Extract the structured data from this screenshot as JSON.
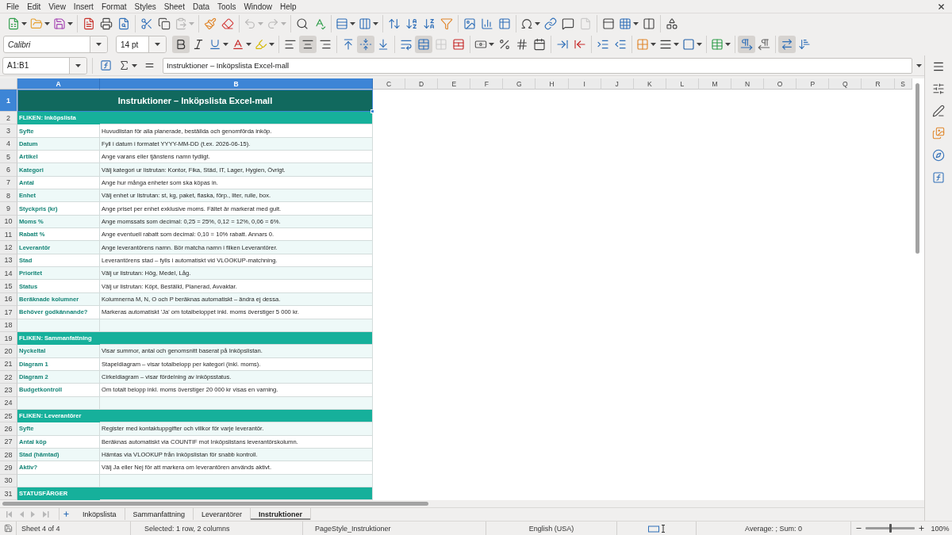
{
  "menu_bar": {
    "items": [
      "File",
      "Edit",
      "View",
      "Insert",
      "Format",
      "Styles",
      "Sheet",
      "Data",
      "Tools",
      "Window",
      "Help"
    ]
  },
  "standard_toolbar": {
    "groups": [
      {
        "items": [
          {
            "kind": "new",
            "dropdown": true,
            "disabled": false
          },
          {
            "kind": "open",
            "dropdown": true,
            "disabled": false
          },
          {
            "kind": "save",
            "dropdown": true,
            "disabled": false
          }
        ]
      },
      {
        "items": [
          {
            "kind": "export_pdf",
            "disabled": false
          },
          {
            "kind": "print",
            "disabled": false
          },
          {
            "kind": "print_preview",
            "disabled": false
          }
        ]
      },
      {
        "items": [
          {
            "kind": "cut",
            "disabled": false
          },
          {
            "kind": "copy",
            "disabled": false
          },
          {
            "kind": "paste",
            "dropdown": true,
            "disabled": true
          }
        ]
      },
      {
        "items": [
          {
            "kind": "clone_formatting",
            "disabled": false
          },
          {
            "kind": "clear_formatting",
            "disabled": false
          }
        ]
      },
      {
        "items": [
          {
            "kind": "undo",
            "dropdown": true,
            "disabled": true
          },
          {
            "kind": "redo",
            "dropdown": true,
            "disabled": true
          }
        ]
      },
      {
        "items": [
          {
            "kind": "find_replace",
            "disabled": false
          },
          {
            "kind": "spelling",
            "disabled": false
          }
        ]
      },
      {
        "items": [
          {
            "kind": "rows",
            "dropdown": true,
            "disabled": false
          },
          {
            "kind": "columns",
            "dropdown": true,
            "disabled": false
          }
        ]
      },
      {
        "items": [
          {
            "kind": "sort",
            "disabled": false
          },
          {
            "kind": "sort_ascending",
            "disabled": false
          },
          {
            "kind": "sort_descending",
            "disabled": false
          },
          {
            "kind": "autofilter",
            "disabled": false
          }
        ]
      },
      {
        "items": [
          {
            "kind": "image",
            "disabled": false
          },
          {
            "kind": "chart",
            "disabled": false
          },
          {
            "kind": "pivot_table",
            "disabled": false
          }
        ]
      },
      {
        "items": [
          {
            "kind": "special_character",
            "dropdown": true,
            "disabled": false
          },
          {
            "kind": "hyperlink",
            "disabled": false
          },
          {
            "kind": "comment",
            "disabled": false
          },
          {
            "kind": "headers_footers",
            "disabled": true
          }
        ]
      },
      {
        "items": [
          {
            "kind": "print_area",
            "disabled": false
          },
          {
            "kind": "freeze",
            "dropdown": true,
            "disabled": false
          },
          {
            "kind": "split_window",
            "disabled": false
          }
        ]
      },
      {
        "items": [
          {
            "kind": "draw_functions",
            "disabled": false
          }
        ]
      }
    ]
  },
  "formatting_toolbar": {
    "font_name": "Calibri",
    "font_size": "14 pt",
    "groups": [
      {
        "items": [
          {
            "kind": "bold",
            "pressed": true,
            "disabled": false
          },
          {
            "kind": "italic",
            "pressed": false,
            "disabled": false
          },
          {
            "kind": "underline",
            "dropdown": true,
            "pressed": false,
            "disabled": false
          },
          {
            "kind": "font_color",
            "dropdown": true,
            "pressed": false,
            "disabled": false
          },
          {
            "kind": "highlight",
            "dropdown": true,
            "pressed": false,
            "disabled": false
          }
        ]
      },
      {
        "items": [
          {
            "kind": "align_left",
            "pressed": false,
            "disabled": false
          },
          {
            "kind": "align_center",
            "pressed": true,
            "disabled": false
          },
          {
            "kind": "align_right",
            "pressed": false,
            "disabled": false
          }
        ]
      },
      {
        "items": [
          {
            "kind": "align_top",
            "pressed": false,
            "disabled": false
          },
          {
            "kind": "align_middle",
            "pressed": true,
            "disabled": false
          },
          {
            "kind": "align_bottom",
            "pressed": false,
            "disabled": false
          }
        ]
      },
      {
        "items": [
          {
            "kind": "wrap_text",
            "pressed": false,
            "disabled": false
          },
          {
            "kind": "merge_center",
            "pressed": true,
            "disabled": false
          },
          {
            "kind": "merge_cells",
            "pressed": false,
            "disabled": true
          },
          {
            "kind": "unmerge",
            "pressed": false,
            "disabled": false
          }
        ]
      },
      {
        "items": [
          {
            "kind": "currency",
            "dropdown": true,
            "pressed": false,
            "disabled": false
          },
          {
            "kind": "percent",
            "pressed": false,
            "disabled": false
          },
          {
            "kind": "number",
            "pressed": false,
            "disabled": false
          },
          {
            "kind": "date",
            "pressed": false,
            "disabled": false
          }
        ]
      },
      {
        "items": [
          {
            "kind": "add_decimal",
            "pressed": false,
            "disabled": false
          },
          {
            "kind": "delete_decimal",
            "pressed": false,
            "disabled": false
          }
        ]
      },
      {
        "items": [
          {
            "kind": "indent_increase",
            "pressed": false,
            "disabled": false
          },
          {
            "kind": "indent_decrease",
            "pressed": false,
            "disabled": false
          }
        ]
      },
      {
        "items": [
          {
            "kind": "borders",
            "dropdown": true,
            "pressed": false,
            "disabled": false
          },
          {
            "kind": "border_style",
            "dropdown": true,
            "pressed": false,
            "disabled": false
          },
          {
            "kind": "border_color",
            "dropdown": true,
            "pressed": false,
            "disabled": false
          }
        ]
      },
      {
        "items": [
          {
            "kind": "conditional",
            "dropdown": true,
            "pressed": false,
            "disabled": false
          }
        ]
      },
      {
        "items": [
          {
            "kind": "ltr",
            "pressed": true,
            "disabled": false
          },
          {
            "kind": "rtl",
            "pressed": false,
            "disabled": false
          }
        ]
      },
      {
        "items": [
          {
            "kind": "horizontal_text",
            "pressed": true,
            "disabled": false
          },
          {
            "kind": "vertical_text",
            "pressed": false,
            "disabled": false
          }
        ]
      }
    ]
  },
  "formula_bar": {
    "name_box": "A1:B1",
    "content": "Instruktioner – Inköpslista Excel-mall"
  },
  "sheet": {
    "columns": [
      {
        "label": "A",
        "selected": true
      },
      {
        "label": "B",
        "selected": true
      },
      {
        "label": "C",
        "selected": false
      },
      {
        "label": "D",
        "selected": false
      },
      {
        "label": "E",
        "selected": false
      },
      {
        "label": "F",
        "selected": false
      },
      {
        "label": "G",
        "selected": false
      },
      {
        "label": "H",
        "selected": false
      },
      {
        "label": "I",
        "selected": false
      },
      {
        "label": "J",
        "selected": false
      },
      {
        "label": "K",
        "selected": false
      },
      {
        "label": "L",
        "selected": false
      },
      {
        "label": "M",
        "selected": false
      },
      {
        "label": "N",
        "selected": false
      },
      {
        "label": "O",
        "selected": false
      },
      {
        "label": "P",
        "selected": false
      },
      {
        "label": "Q",
        "selected": false
      },
      {
        "label": "R",
        "selected": false
      },
      {
        "label": "S",
        "selected": false
      }
    ],
    "rows": [
      {
        "number": "1",
        "selected": true,
        "kind": "title",
        "cells": [
          "Instruktioner – Inköpslista Excel-mall"
        ]
      },
      {
        "number": "2",
        "selected": false,
        "kind": "section",
        "cells": [
          "FLIKEN: Inköpslista"
        ]
      },
      {
        "number": "3",
        "selected": false,
        "kind": "item",
        "cells": [
          "Syfte",
          "Huvudlistan för alla planerade, beställda och genomförda inköp."
        ]
      },
      {
        "number": "4",
        "selected": false,
        "kind": "item",
        "cells": [
          "Datum",
          "Fyll i datum i formatet YYYY-MM-DD (t.ex. 2026-06-15)."
        ]
      },
      {
        "number": "5",
        "selected": false,
        "kind": "item",
        "cells": [
          "Artikel",
          "Ange varans eller tjänstens namn tydligt."
        ]
      },
      {
        "number": "6",
        "selected": false,
        "kind": "item",
        "cells": [
          "Kategori",
          "Välj kategori ur listrutan: Kontor, Fika, Städ, IT, Lager, Hygien, Övrigt."
        ]
      },
      {
        "number": "7",
        "selected": false,
        "kind": "item",
        "cells": [
          "Antal",
          "Ange hur många enheter som ska köpas in."
        ]
      },
      {
        "number": "8",
        "selected": false,
        "kind": "item",
        "cells": [
          "Enhet",
          "Välj enhet ur listrutan: st, kg, paket, flaska, förp., liter, rulle, box."
        ]
      },
      {
        "number": "9",
        "selected": false,
        "kind": "item",
        "cells": [
          "Styckpris (kr)",
          "Ange priset per enhet exklusive moms. Fältet är markerat med gult."
        ]
      },
      {
        "number": "10",
        "selected": false,
        "kind": "item",
        "cells": [
          "Moms %",
          "Ange momssats som decimal: 0,25 = 25%, 0,12 = 12%, 0,06 = 6%."
        ]
      },
      {
        "number": "11",
        "selected": false,
        "kind": "item",
        "cells": [
          "Rabatt %",
          "Ange eventuell rabatt som decimal: 0,10 = 10% rabatt. Annars 0."
        ]
      },
      {
        "number": "12",
        "selected": false,
        "kind": "item",
        "cells": [
          "Leverantör",
          "Ange leverantörens namn. Bör matcha namn i fliken Leverantörer."
        ]
      },
      {
        "number": "13",
        "selected": false,
        "kind": "item",
        "cells": [
          "Stad",
          "Leverantörens stad – fylls i automatiskt vid VLOOKUP-matchning."
        ]
      },
      {
        "number": "14",
        "selected": false,
        "kind": "item",
        "cells": [
          "Prioritet",
          "Välj ur listrutan: Hög, Medel, Låg."
        ]
      },
      {
        "number": "15",
        "selected": false,
        "kind": "item",
        "cells": [
          "Status",
          "Välj ur listrutan: Köpt, Beställd, Planerad, Avvaktar."
        ]
      },
      {
        "number": "16",
        "selected": false,
        "kind": "item",
        "cells": [
          "Beräknade kolumner",
          "Kolumnerna M, N, O och P beräknas automatiskt – ändra ej dessa."
        ]
      },
      {
        "number": "17",
        "selected": false,
        "kind": "item",
        "cells": [
          "Behöver godkännande?",
          "Markeras automatiskt 'Ja' om totalbeloppet inkl. moms överstiger 5 000 kr."
        ]
      },
      {
        "number": "18",
        "selected": false,
        "kind": "blank"
      },
      {
        "number": "19",
        "selected": false,
        "kind": "section",
        "cells": [
          "FLIKEN: Sammanfattning"
        ]
      },
      {
        "number": "20",
        "selected": false,
        "kind": "item",
        "cells": [
          "Nyckeltal",
          "Visar summor, antal och genomsnitt baserat på Inköpslistan."
        ]
      },
      {
        "number": "21",
        "selected": false,
        "kind": "item",
        "cells": [
          "Diagram 1",
          "Stapeldiagram – visar totalbelopp per kategori (inkl. moms)."
        ]
      },
      {
        "number": "22",
        "selected": false,
        "kind": "item",
        "cells": [
          "Diagram 2",
          "Cirkeldiagram – visar fördelning av inköpsstatus."
        ]
      },
      {
        "number": "23",
        "selected": false,
        "kind": "item",
        "cells": [
          "Budgetkontroll",
          "Om totalt belopp inkl. moms överstiger 20 000 kr visas en varning."
        ]
      },
      {
        "number": "24",
        "selected": false,
        "kind": "blank"
      },
      {
        "number": "25",
        "selected": false,
        "kind": "section",
        "cells": [
          "FLIKEN: Leverantörer"
        ]
      },
      {
        "number": "26",
        "selected": false,
        "kind": "item",
        "cells": [
          "Syfte",
          "Register med kontaktuppgifter och villkor för varje leverantör."
        ]
      },
      {
        "number": "27",
        "selected": false,
        "kind": "item",
        "cells": [
          "Antal köp",
          "Beräknas automatiskt via COUNTIF mot Inköpslistans leverantörskolumn."
        ]
      },
      {
        "number": "28",
        "selected": false,
        "kind": "item",
        "cells": [
          "Stad (hämtad)",
          "Hämtas via VLOOKUP från Inköpslistan för snabb kontroll."
        ]
      },
      {
        "number": "29",
        "selected": false,
        "kind": "item",
        "cells": [
          "Aktiv?",
          "Välj Ja eller Nej för att markera om leverantören används aktivt."
        ]
      },
      {
        "number": "30",
        "selected": false,
        "kind": "blank"
      },
      {
        "number": "31",
        "selected": false,
        "kind": "section",
        "cells": [
          "STATUSFÄRGER"
        ]
      }
    ]
  },
  "sheet_tabs": [
    {
      "label": "Inköpslista",
      "selected": false
    },
    {
      "label": "Sammanfattning",
      "selected": false
    },
    {
      "label": "Leverantörer",
      "selected": false
    },
    {
      "label": "Instruktioner",
      "selected": true
    }
  ],
  "status_bar": {
    "sheet": "Sheet 4 of 4",
    "selection": "Selected: 1 row, 2 columns",
    "page_style": "PageStyle_Instruktioner",
    "language": "English (USA)",
    "summary": "Average: ; Sum: 0",
    "zoom": {
      "level": 0.5,
      "value": "100%"
    }
  }
}
